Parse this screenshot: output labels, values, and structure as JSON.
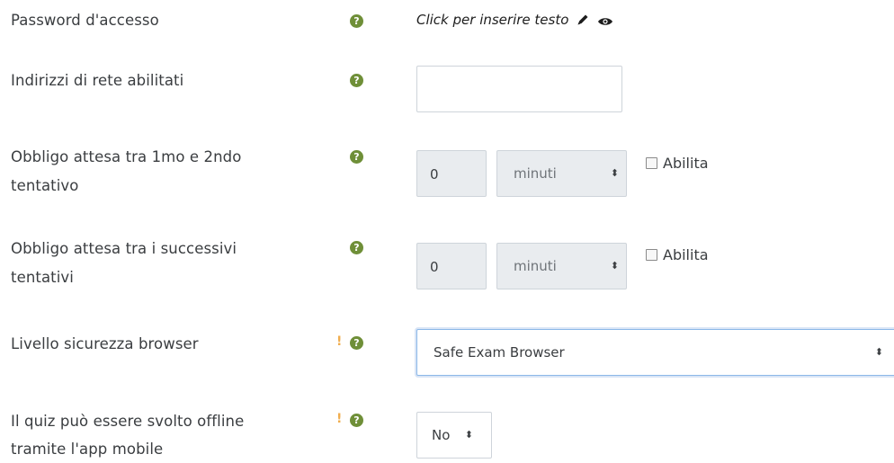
{
  "rows": {
    "password": {
      "label": "Password d'accesso",
      "value": "Click per inserire testo"
    },
    "network": {
      "label": "Indirizzi di rete abilitati",
      "value": ""
    },
    "delay1": {
      "label_line1": "Obbligo attesa tra 1mo e 2ndo",
      "label_line2": "tentativo",
      "number": "0",
      "unit": "minuti",
      "checkbox_label": "Abilita"
    },
    "delay2": {
      "label_line1": "Obbligo attesa tra i successivi",
      "label_line2": "tentativi",
      "number": "0",
      "unit": "minuti",
      "checkbox_label": "Abilita"
    },
    "browser_security": {
      "label": "Livello sicurezza browser",
      "value": "Safe Exam Browser"
    },
    "offline": {
      "label_line1": "Il quiz può essere svolto offline",
      "label_line2": "tramite l'app mobile",
      "value": "No"
    }
  },
  "icons": {
    "help": "question-circle-icon",
    "warning": "exclamation-icon",
    "edit": "pencil-icon",
    "reveal": "eye-icon",
    "select": "sort-caret-icon"
  },
  "colors": {
    "help_icon": "#6f8f38",
    "warning": "#f0ad4e",
    "focus_border": "#8cb8e8",
    "disabled_bg": "#e9ecef"
  },
  "glyphs": {
    "help": "?",
    "warning": "!",
    "caret": "⬍"
  }
}
